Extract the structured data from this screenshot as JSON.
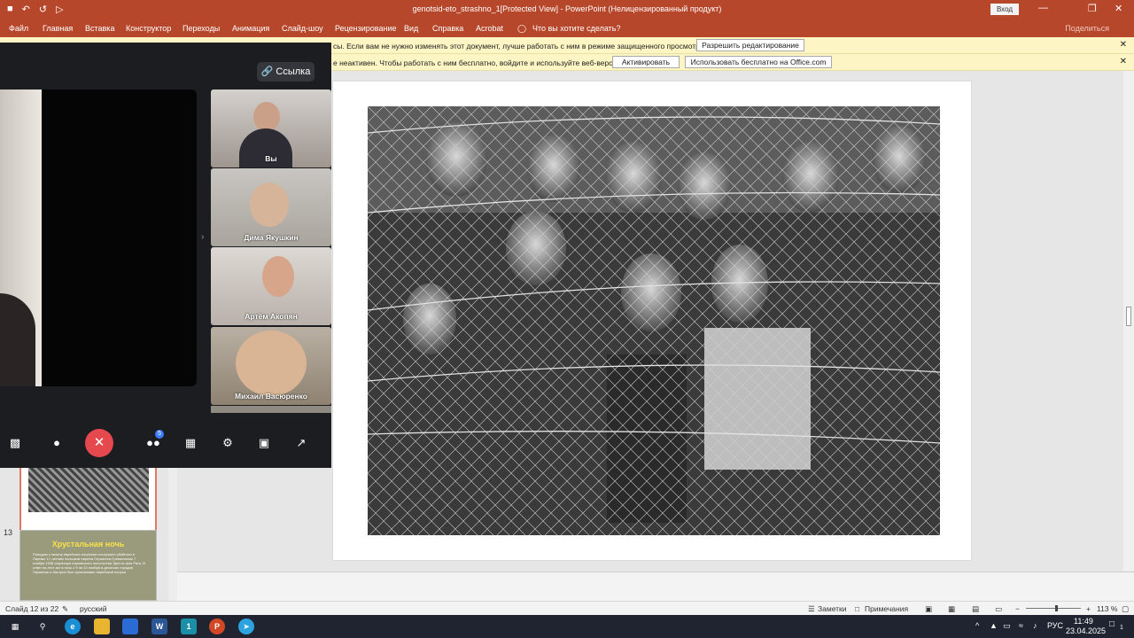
{
  "titlebar": {
    "title": "genotsid-eto_strashno_1[Protected View]  -  PowerPoint (Нелицензированный продукт)",
    "login": "Вход",
    "minimize": "—",
    "restore": "❐",
    "close": "✕",
    "qa_icons": [
      "save-icon",
      "undo-icon",
      "redo-icon",
      "start-from-beginning-icon"
    ]
  },
  "ribbon": {
    "tabs": [
      "Файл",
      "Главная",
      "Вставка",
      "Конструктор",
      "Переходы",
      "Анимация",
      "Слайд-шоу",
      "Рецензирование",
      "Вид",
      "Справка",
      "Acrobat"
    ],
    "tell_me": "Что вы хотите сделать?",
    "share": "Поделиться"
  },
  "message_bars": [
    {
      "text": "сы. Если вам не нужно изменять этот документ, лучше работать с ним в режиме защищенного просмотра.",
      "buttons": [
        "Разрешить редактирование"
      ]
    },
    {
      "text": "е неактивен. Чтобы работать с ним бесплатно, войдите и используйте веб-версию.",
      "buttons": [
        "Активировать",
        "Использовать бесплатно на Office.com"
      ]
    }
  ],
  "thumbnails": {
    "slide13_number": "13",
    "slide13_title": "Хрустальная ночь",
    "slide13_body": "Поводом к началу еврейских погромов послужило убийство в Париже 17-летним польским евреем Гершелем Гриншпаном 7 ноября 1938 секретаря германского посольства Эрнста фон Рата. В ответ на этот акт в ночь с 9 на 10 ноября в десятках городов Германии и Австрии был организован еврейский погром"
  },
  "statusbar": {
    "slide_info": "Слайд 12 из 22",
    "language": "русский",
    "notes": "Заметки",
    "comments": "Примечания",
    "zoom": "113 %",
    "zoom_fraction": 0.56
  },
  "call": {
    "link_label": "Ссылка",
    "participants": [
      {
        "name": "Вы"
      },
      {
        "name": "Дима Якушкин"
      },
      {
        "name": "Артём Акопян"
      },
      {
        "name": "Михаил Васюренко"
      }
    ],
    "participants_badge": "5",
    "controls": [
      "camera-icon",
      "microphone-icon",
      "end-call-icon",
      "participants-icon",
      "grid-view-icon",
      "settings-icon",
      "picture-in-picture-icon",
      "fullscreen-icon"
    ]
  },
  "taskbar": {
    "time": "11:49",
    "date": "23.04.2025",
    "lang": "РУС",
    "notifications": "1",
    "apps": [
      "windows-start-icon",
      "search-icon",
      "edge-icon",
      "file-explorer-icon",
      "store-icon",
      "word-icon",
      "video-call-app-icon",
      "powerpoint-icon",
      "telegram-icon"
    ]
  },
  "colors": {
    "accent": "#b7472a",
    "message_bar": "#fdf5c3",
    "call_bg": "#1c1d21",
    "end_call": "#e5484d"
  }
}
